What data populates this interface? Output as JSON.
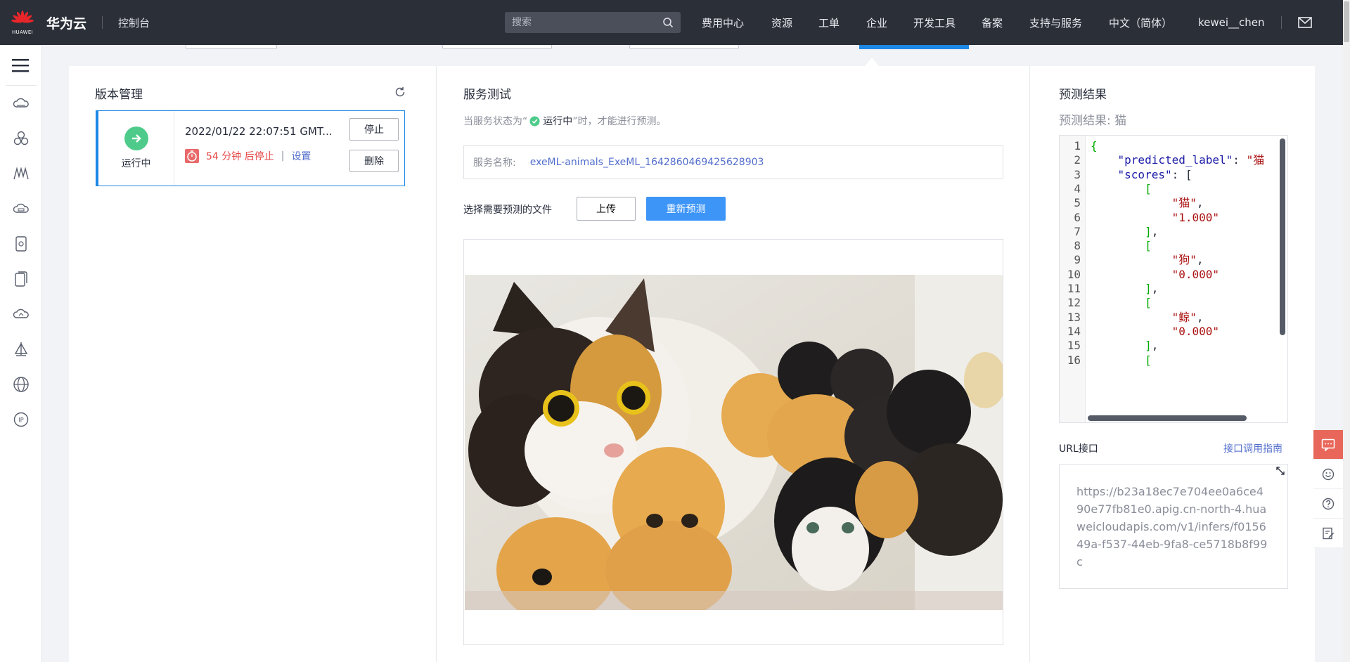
{
  "header": {
    "logo_text": "HUAWEI",
    "brand": "华为云",
    "console": "控制台",
    "search_placeholder": "搜索",
    "nav": [
      "费用中心",
      "资源",
      "工单",
      "企业",
      "开发工具",
      "备案",
      "支持与服务",
      "中文（简体）",
      "kewei__chen"
    ]
  },
  "version": {
    "title": "版本管理",
    "status": "运行中",
    "time": "2022/01/22 22:07:51 GMT...",
    "stop_text": "54 分钟 后停止",
    "setting": "设置",
    "stop_button": "停止",
    "delete_button": "删除"
  },
  "service": {
    "title": "服务测试",
    "hint_prefix": "当服务状态为“",
    "hint_status": "运行中",
    "hint_suffix": "”时，才能进行预测。",
    "name_label": "服务名称:",
    "name_value": "exeML-animals_ExeML_1642860469425628903",
    "file_label": "选择需要预测的文件",
    "upload_button": "上传",
    "repredict_button": "重新预测"
  },
  "prediction": {
    "title": "预测结果",
    "summary": "预测结果:  猫",
    "lines": [
      {
        "n": "1",
        "t": "{"
      },
      {
        "n": "2",
        "t": "    \"predicted_label\": \"猫"
      },
      {
        "n": "3",
        "t": "    \"scores\": ["
      },
      {
        "n": "4",
        "t": "        ["
      },
      {
        "n": "5",
        "t": "            \"猫\","
      },
      {
        "n": "6",
        "t": "            \"1.000\""
      },
      {
        "n": "7",
        "t": "        ],"
      },
      {
        "n": "8",
        "t": "        ["
      },
      {
        "n": "9",
        "t": "            \"狗\","
      },
      {
        "n": "10",
        "t": "            \"0.000\""
      },
      {
        "n": "11",
        "t": "        ],"
      },
      {
        "n": "12",
        "t": "        ["
      },
      {
        "n": "13",
        "t": "            \"鲸\","
      },
      {
        "n": "14",
        "t": "            \"0.000\""
      },
      {
        "n": "15",
        "t": "        ],"
      },
      {
        "n": "16",
        "t": "        ["
      }
    ],
    "url_label": "URL接口",
    "url_guide": "接口调用指南",
    "url_value": "https://b23a18ec7e704ee0a6ce490e77fb81e0.apig.cn-north-4.huaweicloudapis.com/v1/infers/f015649a-f537-44eb-9fa8-ce5718b8f99c"
  },
  "colors": {
    "accent": "#1e88e5",
    "primary_button": "#3d95f8",
    "running_green": "#4ecb8a",
    "stop_red": "#e54545",
    "link": "#526ecc",
    "header_bg": "#2b2f38"
  }
}
